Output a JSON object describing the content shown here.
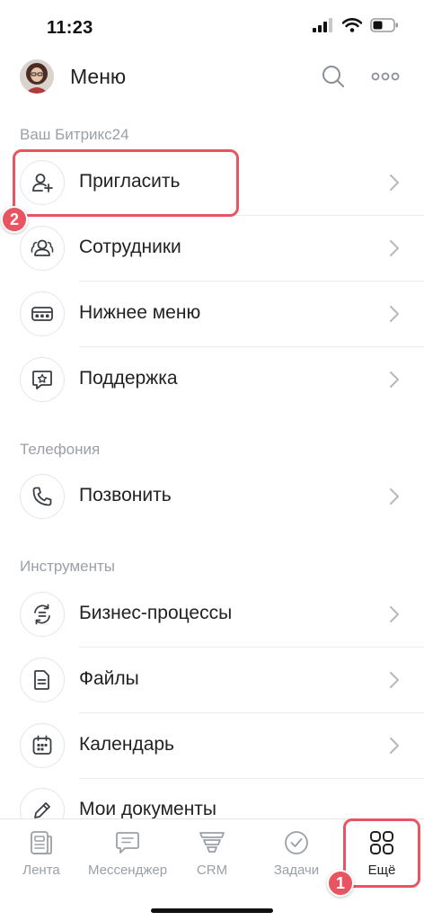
{
  "status_bar": {
    "time": "11:23"
  },
  "header": {
    "title": "Меню"
  },
  "sections": [
    {
      "title": "Ваш Битрикс24",
      "items": [
        {
          "label": "Пригласить",
          "icon": "add-user-icon"
        },
        {
          "label": "Сотрудники",
          "icon": "users-icon"
        },
        {
          "label": "Нижнее меню",
          "icon": "bottom-menu-icon"
        },
        {
          "label": "Поддержка",
          "icon": "support-icon"
        }
      ]
    },
    {
      "title": "Телефония",
      "items": [
        {
          "label": "Позвонить",
          "icon": "phone-icon"
        }
      ]
    },
    {
      "title": "Инструменты",
      "items": [
        {
          "label": "Бизнес-процессы",
          "icon": "business-process-icon"
        },
        {
          "label": "Файлы",
          "icon": "file-icon"
        },
        {
          "label": "Календарь",
          "icon": "calendar-icon"
        },
        {
          "label": "Мои документы",
          "icon": "pen-icon"
        }
      ]
    }
  ],
  "tab_bar": {
    "tabs": [
      {
        "label": "Лента",
        "icon": "feed-icon"
      },
      {
        "label": "Мессенджер",
        "icon": "messenger-icon"
      },
      {
        "label": "CRM",
        "icon": "crm-icon"
      },
      {
        "label": "Задачи",
        "icon": "tasks-icon"
      },
      {
        "label": "Ещё",
        "icon": "more-grid-icon",
        "active": true
      }
    ]
  },
  "annotations": {
    "step_1": "1",
    "step_2": "2"
  },
  "colors": {
    "accent": "#e8545f",
    "text": "#222222",
    "muted": "#9aa0a6",
    "icon": "#3a3f45"
  }
}
